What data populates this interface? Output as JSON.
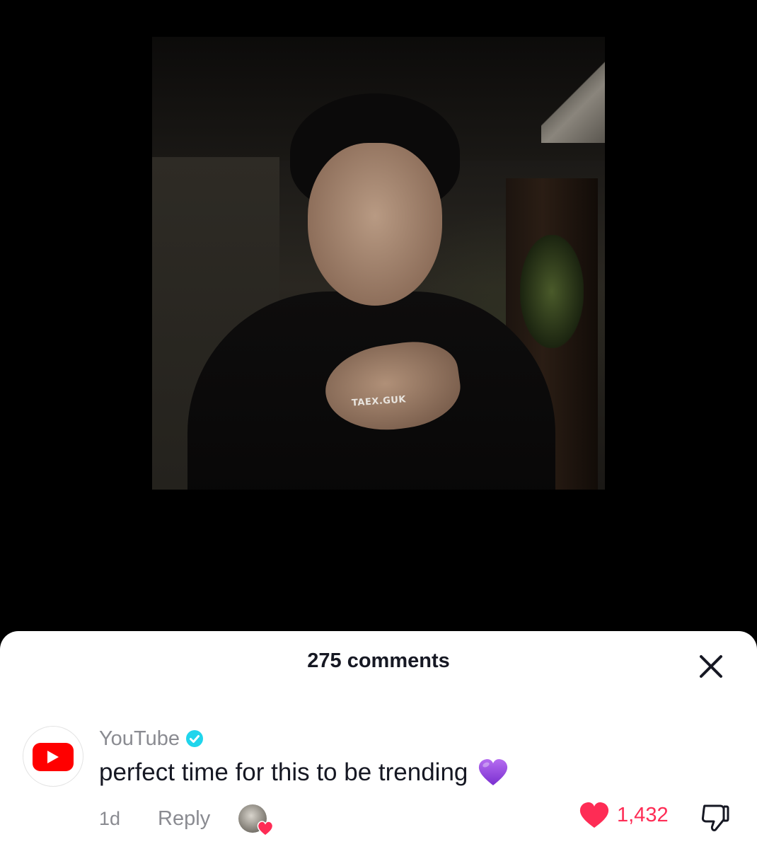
{
  "video": {
    "watermark": "TAEX.GUK"
  },
  "comments_sheet": {
    "title": "275 comments",
    "close_icon": "close-x-icon"
  },
  "comment": {
    "username": "YouTube",
    "verified": true,
    "text": "perfect time for this to be trending",
    "emoji": "purple-heart",
    "time": "1d",
    "reply_label": "Reply",
    "liked_by_creator": true,
    "like_count": "1,432",
    "liked": true
  },
  "colors": {
    "like_red": "#fe2c55",
    "youtube_red": "#ff0000",
    "verified_blue": "#20d5ec",
    "muted_text": "#8a8b91"
  }
}
